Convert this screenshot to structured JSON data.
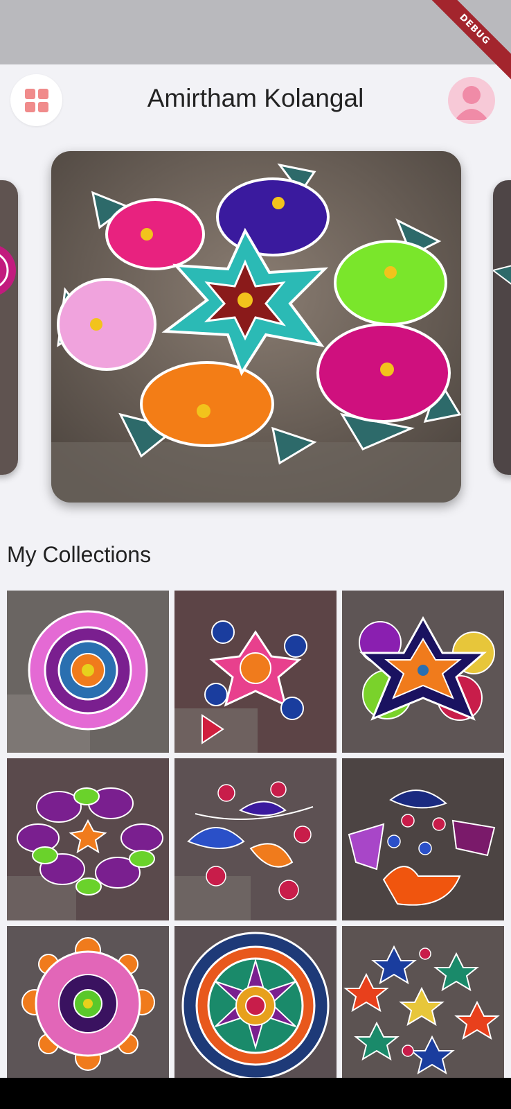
{
  "debug_banner": "DEBUG",
  "app": {
    "title": "Amirtham Kolangal"
  },
  "section": {
    "title": "My Collections"
  },
  "icons": {
    "menu": "grid-menu-icon",
    "profile": "user-avatar-icon"
  },
  "colors": {
    "accent": "#f08b8b",
    "avatar_bg": "#f7c9d7",
    "avatar_fg": "#f08ba7",
    "background": "#f2f2f6"
  },
  "carousel": {
    "items": [
      "kolam-flowers-star",
      "kolam-partial-left",
      "kolam-partial-right"
    ],
    "active_index": 0
  },
  "collections": [
    "kolam-1",
    "kolam-2",
    "kolam-3",
    "kolam-4",
    "kolam-5",
    "kolam-6",
    "kolam-7",
    "kolam-8",
    "kolam-9"
  ]
}
